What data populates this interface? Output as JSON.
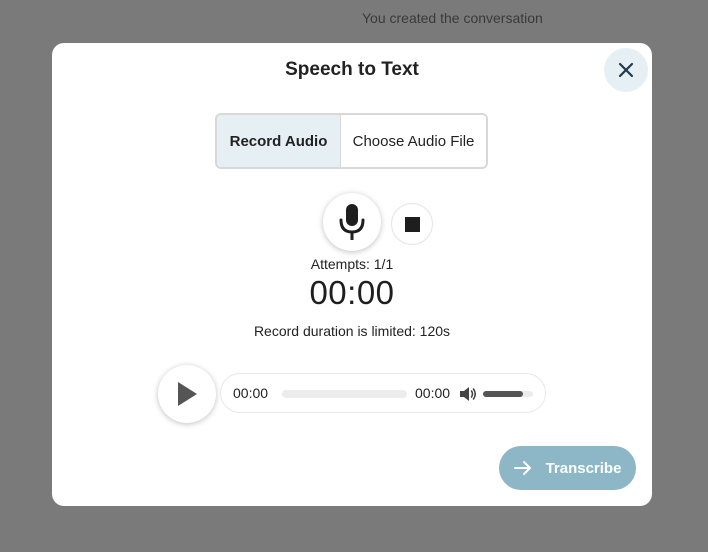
{
  "backdrop": {
    "text": "You created the conversation"
  },
  "dialog": {
    "title": "Speech to Text",
    "close_icon": "close-icon",
    "tabs": [
      {
        "label": "Record Audio",
        "active": true
      },
      {
        "label": "Choose Audio File",
        "active": false
      }
    ],
    "recorder": {
      "mic_icon": "microphone-icon",
      "stop_icon": "stop-icon",
      "attempts": "Attempts: 1/1",
      "timer": "00:00",
      "limit_note": "Record duration is limited: 120s"
    },
    "player": {
      "play_icon": "play-icon",
      "current_time": "00:00",
      "duration": "00:00",
      "progress": 0,
      "volume_icon": "volume-icon",
      "volume_level": 0.8
    },
    "transcribe": {
      "label": "Transcribe",
      "icon": "arrow-right-icon"
    }
  },
  "colors": {
    "overlay": "#7a7a7a",
    "accent_light": "#e6f0f4",
    "button_primary": "#8db6c7"
  }
}
